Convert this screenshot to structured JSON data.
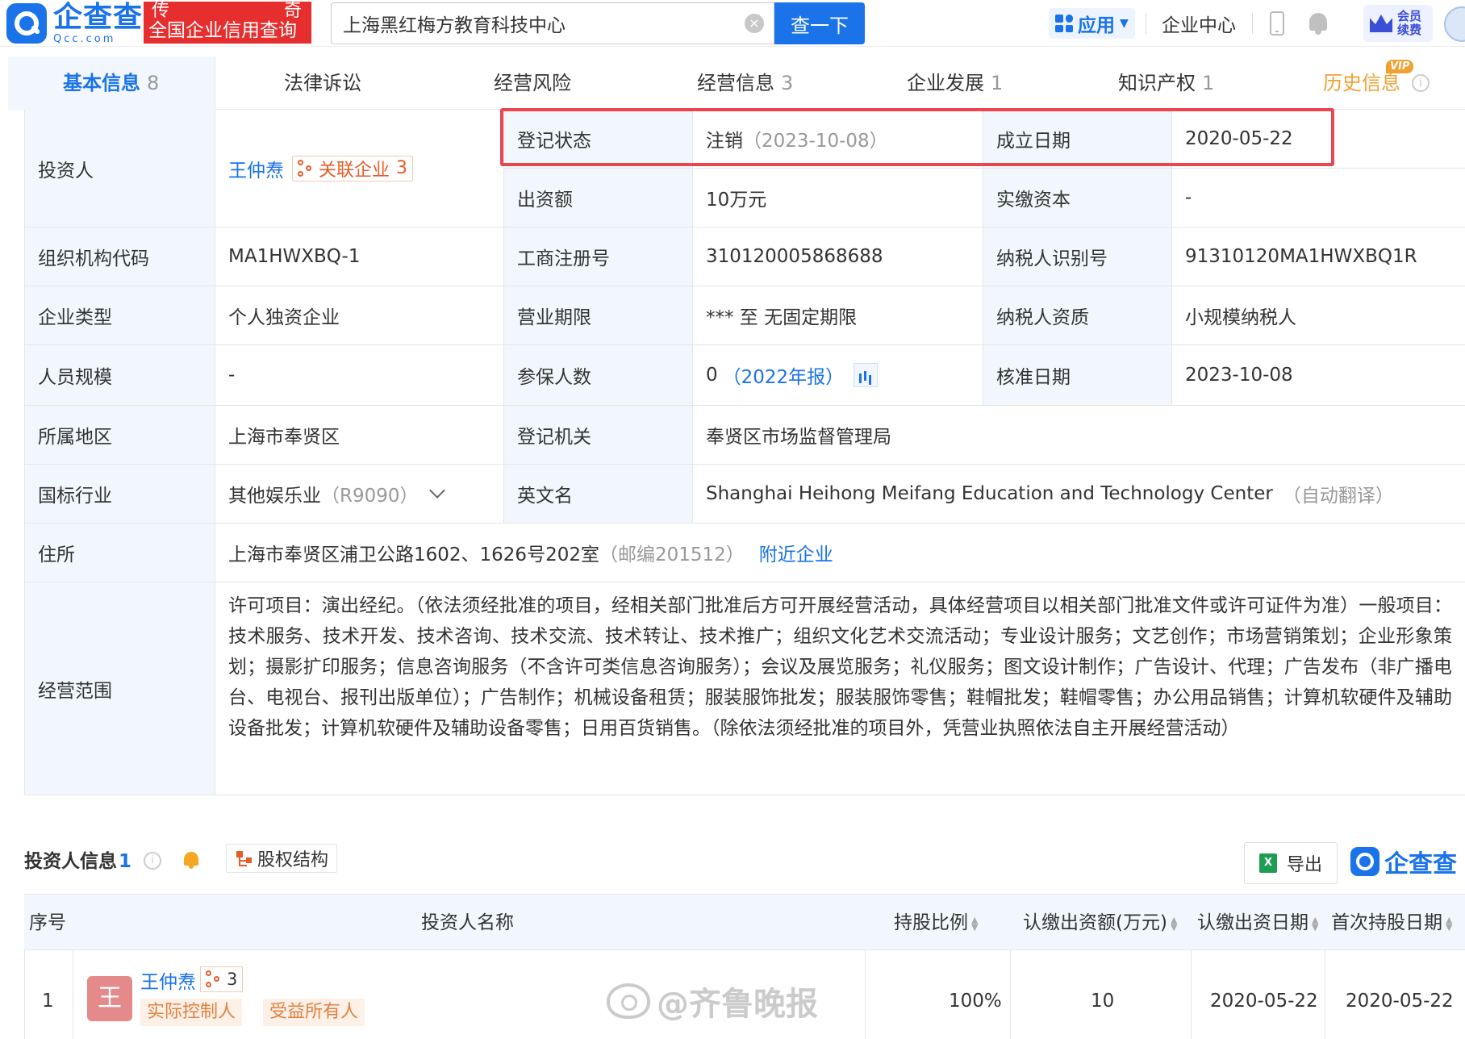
{
  "header": {
    "logo_cn": "企查查",
    "logo_en": "Qcc.com",
    "slogan_left": "传",
    "slogan_right": "奇",
    "slogan_main": "全国企业信用查询",
    "search_value": "上海黑红梅方教育科技中心",
    "search_button": "查一下",
    "apps_label": "应用",
    "enterprise_center": "企业中心",
    "vip_line1": "会员",
    "vip_line2": "续费"
  },
  "tabs": [
    {
      "label": "基本信息",
      "count": "8"
    },
    {
      "label": "法律诉讼",
      "count": ""
    },
    {
      "label": "经营风险",
      "count": ""
    },
    {
      "label": "经营信息",
      "count": "3"
    },
    {
      "label": "企业发展",
      "count": "1"
    },
    {
      "label": "知识产权",
      "count": "1"
    },
    {
      "label": "历史信息",
      "count": ""
    }
  ],
  "history_vip_tag": "VIP",
  "info": {
    "investor_label": "投资人",
    "investor_name": "王仲焘",
    "related_label": "关联企业",
    "related_count": "3",
    "status_label": "登记状态",
    "status_value": "注销",
    "status_date": "（2023-10-08）",
    "founded_label": "成立日期",
    "founded_value": "2020-05-22",
    "capital_label": "出资额",
    "capital_value": "10万元",
    "paid_label": "实缴资本",
    "paid_value": "-",
    "org_code_label": "组织机构代码",
    "org_code_value": "MA1HWXBQ-1",
    "reg_no_label": "工商注册号",
    "reg_no_value": "310120005868688",
    "tax_id_label": "纳税人识别号",
    "tax_id_value": "91310120MA1HWXBQ1R",
    "type_label": "企业类型",
    "type_value": "个人独资企业",
    "term_label": "营业期限",
    "term_value": "*** 至 无固定期限",
    "tax_qual_label": "纳税人资质",
    "tax_qual_value": "小规模纳税人",
    "staff_label": "人员规模",
    "staff_value": "-",
    "insured_label": "参保人数",
    "insured_value": "0",
    "insured_report": "（2022年报）",
    "approved_label": "核准日期",
    "approved_value": "2023-10-08",
    "region_label": "所属地区",
    "region_value": "上海市奉贤区",
    "authority_label": "登记机关",
    "authority_value": "奉贤区市场监督管理局",
    "industry_label": "国标行业",
    "industry_value": "其他娱乐业",
    "industry_code": "（R9090）",
    "english_label": "英文名",
    "english_value": "Shanghai Heihong Meifang Education and Technology Center",
    "english_note": "（自动翻译）",
    "address_label": "住所",
    "address_value": "上海市奉贤区浦卫公路1602、1626号202室",
    "address_zip": "（邮编201512）",
    "nearby_link": "附近企业",
    "scope_label": "经营范围",
    "scope_value": "许可项目：演出经纪。（依法须经批准的项目，经相关部门批准后方可开展经营活动，具体经营项目以相关部门批准文件或许可证件为准）一般项目：技术服务、技术开发、技术咨询、技术交流、技术转让、技术推广；组织文化艺术交流活动；专业设计服务；文艺创作；市场营销策划；企业形象策划；摄影扩印服务；信息咨询服务（不含许可类信息咨询服务）；会议及展览服务；礼仪服务；图文设计制作；广告设计、代理；广告发布（非广播电台、电视台、报刊出版单位）；广告制作；机械设备租赁；服装服饰批发；服装服饰零售；鞋帽批发；鞋帽零售；办公用品销售；计算机软硬件及辅助设备批发；计算机软硬件及辅助设备零售；日用百货销售。（除依法须经批准的项目外，凭营业执照依法自主开展经营活动）"
  },
  "shareholders": {
    "title": "投资人信息",
    "count": "1",
    "equity_button": "股权结构",
    "export_button": "导出",
    "excel_glyph": "X",
    "brand": "企查查",
    "columns": [
      "序号",
      "投资人名称",
      "持股比例",
      "认缴出资额(万元)",
      "认缴出资日期",
      "首次持股日期"
    ],
    "rows": [
      {
        "index": "1",
        "avatar": "王",
        "name": "王仲焘",
        "related_count": "3",
        "tags": [
          "实际控制人",
          "受益所有人"
        ],
        "ratio": "100%",
        "amount": "10",
        "subscribe_date": "2020-05-22",
        "first_date": "2020-05-22"
      }
    ]
  },
  "watermark": "@齐鲁晚报",
  "colors": {
    "brand_blue": "#1a73e8",
    "slogan_red": "#e62e2e",
    "highlight_red": "#e8474f",
    "history_orange": "#f0a030"
  }
}
